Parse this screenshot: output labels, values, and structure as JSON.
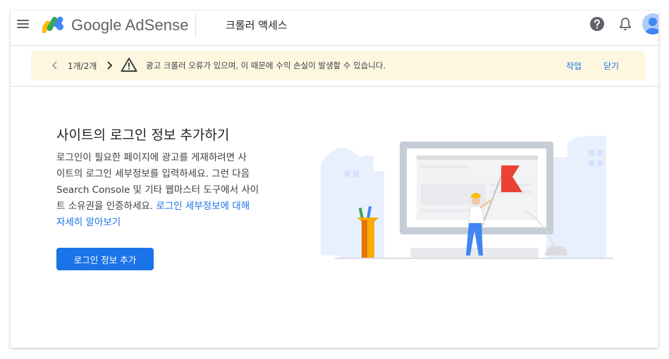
{
  "header": {
    "brand": "Google AdSense",
    "page_title": "크롤러 액세스"
  },
  "banner": {
    "counter": "1개/2개",
    "message": "광고 크롤러 오류가 있으며, 이 때문에 수익 손실이 발생할 수 있습니다.",
    "action_label": "작업",
    "close_label": "닫기"
  },
  "content": {
    "heading": "사이트의 로그인 정보 추가하기",
    "desc_lines": [
      "로그인이 필요한 페이지에 광고를 게재하려면 사",
      "이트의 로그인 세부정보를 입력하세요. 그런 다음",
      "Search Console 및 기타 웹마스터 도구에서 사이"
    ],
    "desc_line4_pre": "트 소유권을 인증하세요. ",
    "desc_link_part1": "로그인 세부정보에 대해",
    "desc_link_part2": "자세히 알아보기",
    "button_label": "로그인 정보 추가"
  },
  "colors": {
    "accent": "#1a73e8",
    "banner_bg": "#fef7e0",
    "flag_red": "#ea4335",
    "pencil_yellow": "#f9ab00"
  },
  "icons": [
    "menu-icon",
    "adsense-logo-icon",
    "help-icon",
    "notifications-icon",
    "avatar-icon",
    "chevron-left-icon",
    "chevron-right-icon",
    "warning-icon"
  ]
}
